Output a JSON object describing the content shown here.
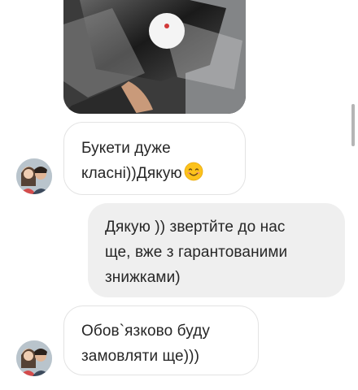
{
  "messages": [
    {
      "sender": "contact",
      "lines": [
        "Букети дуже",
        "класні))Дякую"
      ],
      "emoji": "smiling-face-emoji"
    },
    {
      "sender": "me",
      "lines": [
        "Дякую )) звертйте до нас",
        "ще, вже з гарантованими",
        "знижками)"
      ]
    },
    {
      "sender": "contact",
      "lines": [
        "Обов`язково буду",
        "замовляти ще)))"
      ]
    }
  ],
  "colors": {
    "incoming_bubble_border": "#e3e3e3",
    "outgoing_bubble_bg": "#efefef",
    "text": "#262626"
  }
}
